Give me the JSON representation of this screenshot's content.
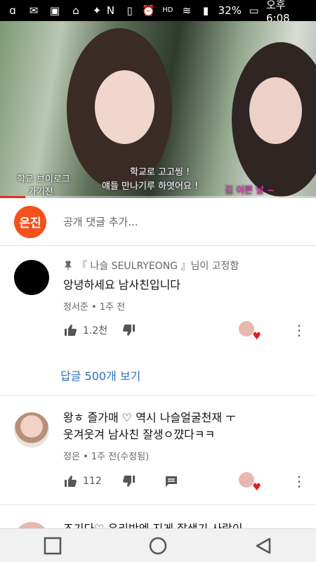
{
  "status_bar": {
    "battery": "32%",
    "time_label": "오후 6:08"
  },
  "video": {
    "caption_left_1": "학교 브이로그",
    "caption_left_2": "가기전",
    "caption_center_1": "학교로 고고씽 !",
    "caption_center_2": "얘들 만나기루 하엿어요 !",
    "caption_right": "김 이쁜 날 ~",
    "progress": 0.08
  },
  "add_comment": {
    "user_avatar_text": "은진",
    "placeholder": "공개 댓글 추가..."
  },
  "comments": [
    {
      "pinned_label": "『 나슬 SEULRYEONG 』님이 고정함",
      "text": "앙녕하세요 남사친입니다",
      "author": "정서준",
      "time": "1주 전",
      "likes": "1.2천",
      "replies_label": "답글 500개 보기"
    },
    {
      "text_line1": "왕ㅎ 즐가매 ♡ 역시 나슬얼굴천재 ㅜ",
      "text_line2": "웃겨웃겨  남사친 잘생ㅇ꺘다ㅋㅋ",
      "author": "정은",
      "time": "1주 전(수정됨)",
      "likes": "112"
    },
    {
      "text_partial": "즈기다♡ 우리반엔 지게 잘생기 사람이"
    }
  ],
  "colors": {
    "accent_red": "#e52d27",
    "link_blue": "#2b6fc2",
    "avatar_orange": "#f4511e"
  }
}
